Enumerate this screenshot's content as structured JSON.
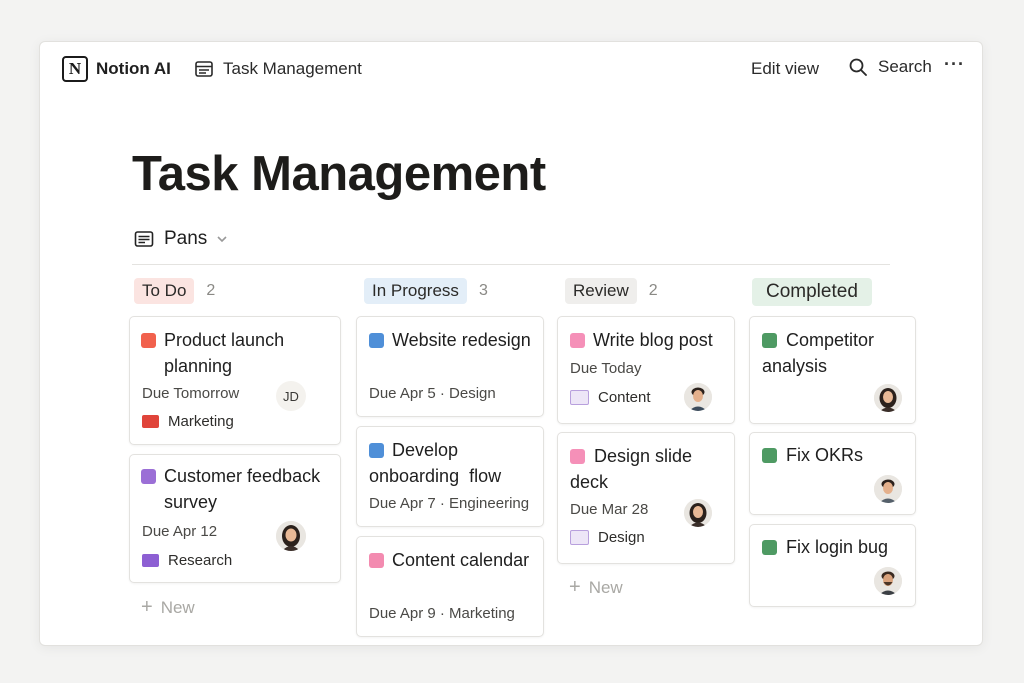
{
  "header": {
    "brand": "Notion AI",
    "breadcrumb": "Task Management",
    "edit_view": "Edit view",
    "search": "Search",
    "more": "···"
  },
  "page": {
    "title": "Task Management",
    "view_name": "Pans"
  },
  "columns": [
    {
      "name": "To Do",
      "count": "2",
      "pill_bg": "#fbe4e1",
      "pill_color": "#2c2b29",
      "cards": [
        {
          "title": "Product launch planning",
          "color": "#f1614d",
          "meta": "Due Tomorrow",
          "tag": "Marketing",
          "tag_color": "#e0443a",
          "avatar": "JD"
        },
        {
          "title": "Customer feedback survey",
          "color": "#9b6fd6",
          "meta": "Due Apr 12",
          "tag": "Research",
          "tag_color": "#8d5fd3",
          "avatar": "woman-dark-hair"
        }
      ],
      "new_label": "New"
    },
    {
      "name": "In Progress",
      "count": "3",
      "pill_bg": "#e3eef8",
      "pill_color": "#2c2b29",
      "cards": [
        {
          "title": "Website redesign",
          "color": "#4f8fd8",
          "meta": "Due Apr 5 · Design"
        },
        {
          "title": "Develop onboarding  flow",
          "color": "#4f8fd8",
          "meta": "Due Apr 7 · Engineering"
        },
        {
          "title": "Content calendar",
          "color": "#f38bb0",
          "meta": "Due Apr 9 · Marketing"
        }
      ]
    },
    {
      "name": "Review",
      "count": "2",
      "pill_bg": "#efeeec",
      "pill_color": "#2c2b29",
      "cards": [
        {
          "title": "Write blog post",
          "color": "#f590b8",
          "meta": "Due Today",
          "tag": "Content",
          "tag_color": "#b8a0dd",
          "avatar": "man-dark-hair"
        },
        {
          "title": "Design slide deck",
          "color": "#f590b8",
          "meta": "Due Mar 28",
          "tag": "Design",
          "tag_color": "#b8a0dd",
          "avatar": "woman-dark-hair"
        }
      ],
      "new_label": "New"
    },
    {
      "name": "Completed",
      "count": "",
      "pill_bg": "#e4f1e7",
      "pill_color": "#1f2d22",
      "cards": [
        {
          "title": "Competitor analysis",
          "color": "#4e9a63",
          "avatar": "woman-dark-hair"
        },
        {
          "title": "Fix OKRs",
          "color": "#4e9a63",
          "avatar": "man-dark-hair"
        },
        {
          "title": "Fix login bug",
          "color": "#4e9a63",
          "avatar": "man-beard"
        }
      ]
    }
  ],
  "icons": {
    "brand": "notion-logo-icon",
    "breadcrumb": "table-icon",
    "search": "search-icon",
    "more": "more-horizontal-icon",
    "view": "board-view-icon",
    "view_chevron": "chevron-down-icon",
    "new": "plus-icon"
  }
}
